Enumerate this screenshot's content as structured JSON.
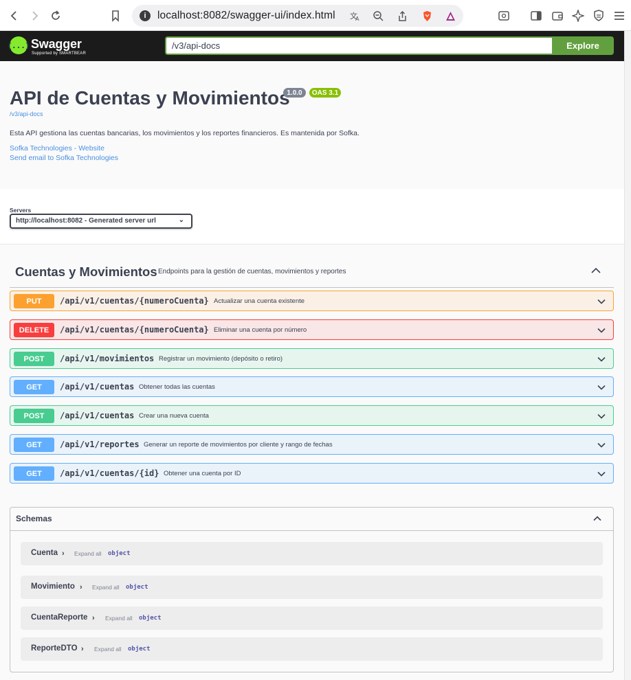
{
  "browser": {
    "url": "localhost:8082/swagger-ui/index.html"
  },
  "topbar": {
    "logo_title": "Swagger",
    "logo_subtitle": "Supported by SMARTBEAR",
    "logo_glyph": "{...}",
    "api_url": "/v3/api-docs",
    "explore_label": "Explore"
  },
  "info": {
    "title": "API de Cuentas y Movimientos",
    "version": "1.0.0",
    "oas": "OAS 3.1",
    "spec_url": "/v3/api-docs",
    "description": "Esta API gestiona las cuentas bancarias, los movimientos y los reportes financieros. Es mantenida por Sofka.",
    "website_link": "Sofka Technologies - Website",
    "email_link": "Send email to Sofka Technologies"
  },
  "servers": {
    "label": "Servers",
    "selected": "http://localhost:8082 - Generated server url"
  },
  "tag": {
    "name": "Cuentas y Movimientos",
    "description": "Endpoints para la gestión de cuentas, movimientos y reportes"
  },
  "operations": [
    {
      "method": "PUT",
      "path": "/api/v1/cuentas/{numeroCuenta}",
      "summary": "Actualizar una cuenta existente"
    },
    {
      "method": "DELETE",
      "path": "/api/v1/cuentas/{numeroCuenta}",
      "summary": "Eliminar una cuenta por número"
    },
    {
      "method": "POST",
      "path": "/api/v1/movimientos",
      "summary": "Registrar un movimiento (depósito o retiro)"
    },
    {
      "method": "GET",
      "path": "/api/v1/cuentas",
      "summary": "Obtener todas las cuentas"
    },
    {
      "method": "POST",
      "path": "/api/v1/cuentas",
      "summary": "Crear una nueva cuenta"
    },
    {
      "method": "GET",
      "path": "/api/v1/reportes",
      "summary": "Generar un reporte de movimientos por cliente y rango de fechas"
    },
    {
      "method": "GET",
      "path": "/api/v1/cuentas/{id}",
      "summary": "Obtener una cuenta por ID"
    }
  ],
  "schemas": {
    "title": "Schemas",
    "models": [
      {
        "name": "Cuenta",
        "expand": "Expand all",
        "type": "object"
      },
      {
        "name": "Movimiento",
        "expand": "Expand all",
        "type": "object"
      },
      {
        "name": "CuentaReporte",
        "expand": "Expand all",
        "type": "object"
      },
      {
        "name": "ReporteDTO",
        "expand": "Expand all",
        "type": "object"
      }
    ]
  },
  "colors": {
    "put": "#fca130",
    "delete": "#f93e3e",
    "post": "#49cc90",
    "get": "#61affe",
    "explore": "#62a03f",
    "topbar": "#1b1b1b"
  }
}
